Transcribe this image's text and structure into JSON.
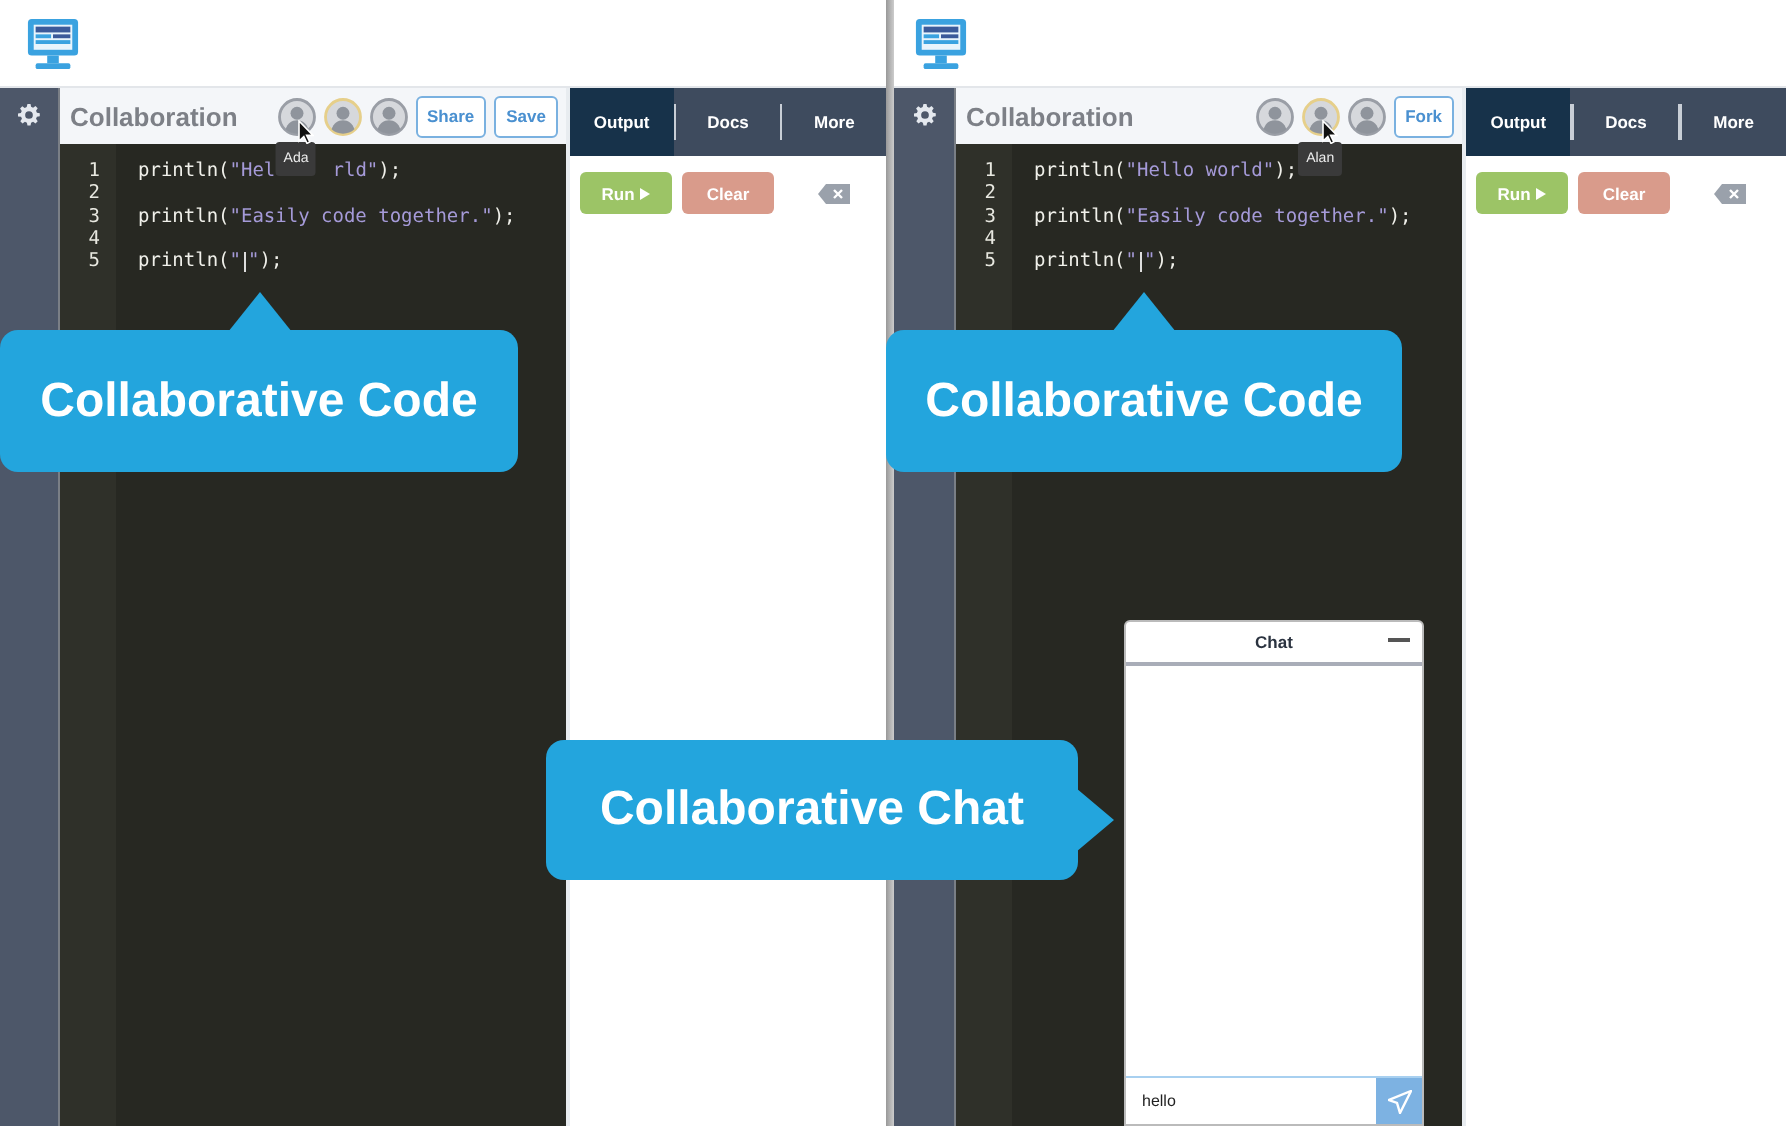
{
  "panes": [
    {
      "title": "Collaboration",
      "avatars": [
        {
          "highlighted": false,
          "tooltip": "Ada",
          "pointer": true
        },
        {
          "highlighted": true
        },
        {
          "highlighted": false
        }
      ],
      "buttons": [
        "Share",
        "Save"
      ],
      "code": [
        {
          "number": "1",
          "segments": [
            {
              "kind": "plain",
              "text": "println("
            },
            {
              "kind": "string",
              "text": "\"Hel"
            },
            {
              "kind": "hidden"
            },
            {
              "kind": "string",
              "text": "rld\""
            },
            {
              "kind": "plain",
              "text": ");"
            }
          ]
        },
        {
          "number": "2"
        },
        {
          "number": "3",
          "segments": [
            {
              "kind": "plain",
              "text": "println("
            },
            {
              "kind": "string",
              "text": "\"Easily code together.\""
            },
            {
              "kind": "plain",
              "text": ");"
            }
          ]
        },
        {
          "number": "4"
        },
        {
          "number": "5",
          "segments": [
            {
              "kind": "plain",
              "text": "println("
            },
            {
              "kind": "string",
              "text": "\""
            },
            {
              "kind": "caret"
            },
            {
              "kind": "string",
              "text": "\""
            },
            {
              "kind": "plain",
              "text": ");"
            }
          ]
        }
      ],
      "tabs": [
        {
          "label": "Output",
          "selected": true
        },
        {
          "label": "Docs",
          "selected": false
        },
        {
          "label": "More",
          "selected": false
        }
      ],
      "run": "Run",
      "clear": "Clear",
      "callout": "Collaborative Code"
    },
    {
      "title": "Collaboration",
      "avatars": [
        {
          "highlighted": false
        },
        {
          "highlighted": true,
          "tooltip": "Alan",
          "pointer": true
        },
        {
          "highlighted": false
        }
      ],
      "buttons": [
        "Fork"
      ],
      "code": [
        {
          "number": "1",
          "segments": [
            {
              "kind": "plain",
              "text": "println("
            },
            {
              "kind": "string",
              "text": "\"Hello world\""
            },
            {
              "kind": "plain",
              "text": ");"
            }
          ]
        },
        {
          "number": "2"
        },
        {
          "number": "3",
          "segments": [
            {
              "kind": "plain",
              "text": "println("
            },
            {
              "kind": "string",
              "text": "\"Easily code together.\""
            },
            {
              "kind": "plain",
              "text": ");"
            }
          ]
        },
        {
          "number": "4"
        },
        {
          "number": "5",
          "segments": [
            {
              "kind": "plain",
              "text": "println("
            },
            {
              "kind": "string",
              "text": "\""
            },
            {
              "kind": "caret"
            },
            {
              "kind": "string",
              "text": "\""
            },
            {
              "kind": "plain",
              "text": ");"
            }
          ]
        }
      ],
      "tabs": [
        {
          "label": "Output",
          "selected": true
        },
        {
          "label": "Docs",
          "selected": false
        },
        {
          "label": "More",
          "selected": false
        }
      ],
      "run": "Run",
      "clear": "Clear",
      "callout": "Collaborative Code",
      "chat": {
        "title": "Chat",
        "input": "hello"
      }
    }
  ],
  "chat_callout": "Collaborative Chat"
}
